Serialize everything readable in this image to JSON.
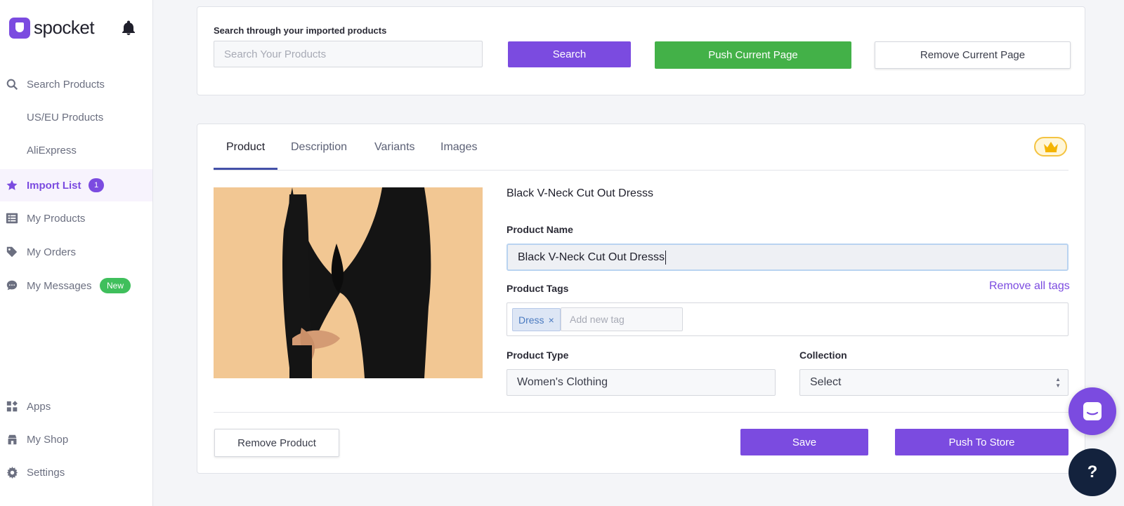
{
  "app": {
    "logo_text": "spocket"
  },
  "sidebar": {
    "items": [
      {
        "label": "Search Products",
        "icon": "search-icon"
      },
      {
        "label": "US/EU Products",
        "icon": ""
      },
      {
        "label": "AliExpress",
        "icon": ""
      },
      {
        "label": "Import List",
        "icon": "star-icon",
        "badge": "1",
        "active": true
      },
      {
        "label": "My Products",
        "icon": "list-icon"
      },
      {
        "label": "My Orders",
        "icon": "tag-icon"
      },
      {
        "label": "My Messages",
        "icon": "chat-icon",
        "badge": "New"
      },
      {
        "label": "Apps",
        "icon": "apps-icon"
      },
      {
        "label": "My Shop",
        "icon": "shop-icon"
      },
      {
        "label": "Settings",
        "icon": "gear-icon"
      }
    ]
  },
  "search": {
    "label": "Search through your imported products",
    "placeholder": "Search Your Products",
    "search_button": "Search",
    "push_page_button": "Push Current Page",
    "remove_page_button": "Remove Current Page"
  },
  "product": {
    "tabs": [
      "Product",
      "Description",
      "Variants",
      "Images"
    ],
    "active_tab": "Product",
    "title": "Black V-Neck Cut Out Dresss",
    "name_label": "Product Name",
    "name_value": "Black V-Neck Cut Out Dresss",
    "tags_label": "Product Tags",
    "remove_all_tags": "Remove all tags",
    "tags": [
      "Dress"
    ],
    "tag_remove_symbol": "×",
    "tag_placeholder": "Add new tag",
    "type_label": "Product Type",
    "type_value": "Women's Clothing",
    "collection_label": "Collection",
    "collection_value": "Select",
    "remove_button": "Remove Product",
    "save_button": "Save",
    "push_button": "Push To Store"
  },
  "help": {
    "label": "?"
  },
  "colors": {
    "brand": "#7b4be0",
    "green": "#43b148",
    "new_badge": "#3fbf5c",
    "help_bg": "#13223d"
  }
}
